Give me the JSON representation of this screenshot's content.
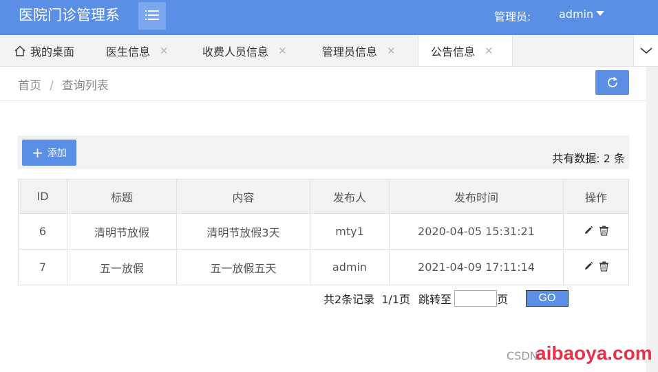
{
  "header": {
    "app_title": "医院门诊管理系",
    "admin_label": "管理员:",
    "admin_name": "admin",
    "menu_icon": "list-icon"
  },
  "tabs": [
    {
      "label": "我的桌面",
      "icon": "home-icon"
    },
    {
      "label": "医生信息",
      "closable": true
    },
    {
      "label": "收费人员信息",
      "closable": true
    },
    {
      "label": "管理员信息",
      "closable": true
    },
    {
      "label": "公告信息",
      "closable": true,
      "active": true
    }
  ],
  "tab_close_glyph": "✕",
  "breadcrumb": {
    "home": "首页",
    "separator": "/",
    "current": "查询列表"
  },
  "toolbar": {
    "add_label": "添加",
    "total_text": "共有数据: 2 条"
  },
  "table": {
    "columns": [
      "ID",
      "标题",
      "内容",
      "发布人",
      "发布时间",
      "操作"
    ],
    "rows": [
      {
        "id": "6",
        "title": "清明节放假",
        "content": "清明节放假3天",
        "publisher": "mty1",
        "time": "2020-04-05 15:31:21"
      },
      {
        "id": "7",
        "title": "五一放假",
        "content": "五一放假五天",
        "publisher": "admin",
        "time": "2021-04-09 17:11:14"
      }
    ]
  },
  "pager": {
    "records": "共2条记录",
    "pages": "1/1页",
    "jump_label": "跳转至",
    "page_unit": "页",
    "jump_value": "",
    "go_label": "GO"
  },
  "watermark": {
    "small": "CSDN",
    "big": "aibaoya.com"
  },
  "colors": {
    "accent": "#5b8fe6",
    "header_bg": "#5b8fe6",
    "menu_btn": "#7aa7ef",
    "tab_bar": "#f3f3f3"
  }
}
